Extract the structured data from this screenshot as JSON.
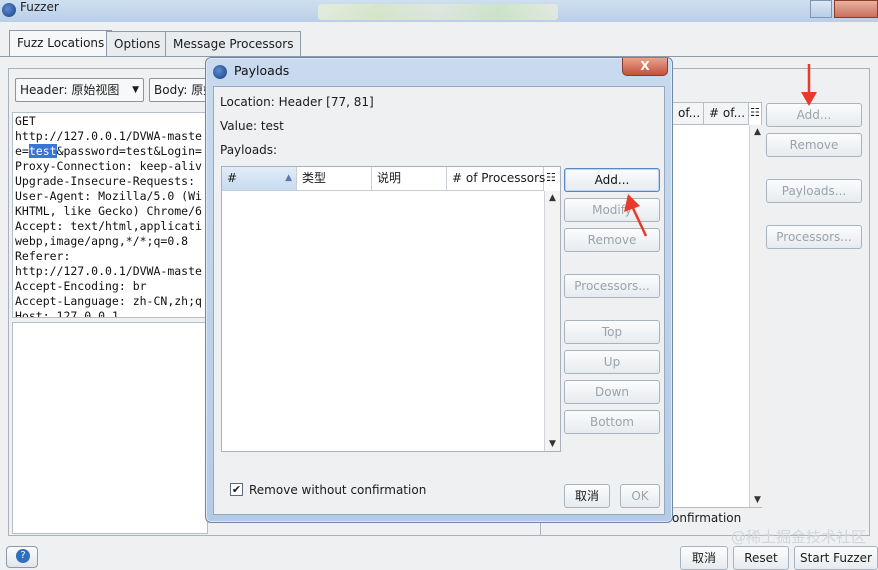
{
  "window": {
    "title": "Fuzzer",
    "tabs": [
      "Fuzz Locations",
      "Options",
      "Message Processors"
    ]
  },
  "fuzz_locations": {
    "header_combo": "Header: 原始视图",
    "body_combo": "Body: 原始",
    "request_lines": [
      "GET",
      "http://127.0.0.1/DVWA-maste",
      "e=test&password=test&Login=",
      "Proxy-Connection: keep-aliv",
      "Upgrade-Insecure-Requests:",
      "User-Agent: Mozilla/5.0 (Wi",
      "KHTML, like Gecko) Chrome/6",
      "Accept: text/html,applicati",
      "webp,image/apng,*/*;q=0.8",
      "Referer:",
      "http://127.0.0.1/DVWA-maste",
      "Accept-Encoding: br",
      "Accept-Language: zh-CN,zh;q",
      "Host: 127.0.0.1"
    ],
    "table_headers": [
      "of...",
      "# of..."
    ],
    "buttons": {
      "add": "Add...",
      "remove": "Remove",
      "payloads": "Payloads...",
      "processors": "Processors..."
    },
    "confirm_text": "onfirmation"
  },
  "footer": {
    "cancel": "取消",
    "reset": "Reset",
    "start": "Start Fuzzer"
  },
  "dialog": {
    "title": "Payloads",
    "close_label": "X",
    "location_label": "Location:",
    "location_value": "Header [77, 81]",
    "value_label": "Value:",
    "value_value": "test",
    "payloads_label": "Payloads:",
    "columns": [
      "#",
      "类型",
      "说明",
      "# of Processors"
    ],
    "buttons": {
      "add": "Add...",
      "modify": "Modify",
      "remove": "Remove",
      "processors": "Processors...",
      "top": "Top",
      "up": "Up",
      "down": "Down",
      "bottom": "Bottom",
      "cancel": "取消",
      "ok": "OK"
    },
    "checkbox_label": "Remove without confirmation",
    "checkbox_checked": true
  },
  "watermark": "@稀土掘金技术社区",
  "colors": {
    "annotation_arrow": "#e8392b",
    "selection": "#3875d7",
    "dialog_frame": "#b4cbe7"
  }
}
